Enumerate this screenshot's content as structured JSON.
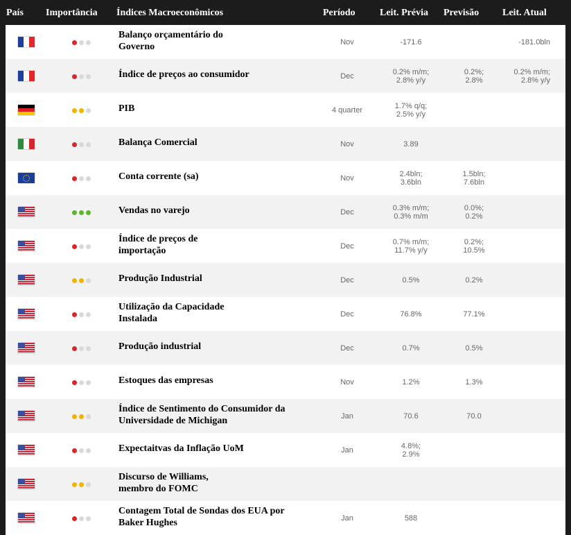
{
  "header": {
    "country": "País",
    "importance": "Importância",
    "indicator": "Índices Macroeconômicos",
    "period": "Período",
    "previous": "Leit. Prévia",
    "forecast": "Previsão",
    "actual": "Leit. Atual"
  },
  "colors": {
    "importance_low": "#d6282b",
    "importance_medium": "#f0b400",
    "importance_high": "#5cb82a",
    "dot_inactive": "#d9d9d9"
  },
  "rows": [
    {
      "flag": "france-flag-icon",
      "importance": "low",
      "name": [
        "Balanço orçamentário do",
        "Governo"
      ],
      "period": "Nov",
      "previous": [
        "-171.6"
      ],
      "forecast": [],
      "actual": [
        "-181.0bln"
      ]
    },
    {
      "flag": "france-flag-icon",
      "importance": "low",
      "name": [
        "Índice de preços ao consumidor"
      ],
      "period": "Dec",
      "previous": [
        "0.2% m/m;",
        "2.8% y/y"
      ],
      "forecast": [
        "0.2%;",
        "2.8%"
      ],
      "actual": [
        "0.2% m/m;",
        "2.8% y/y"
      ]
    },
    {
      "flag": "germany-flag-icon",
      "importance": "medium",
      "name": [
        "PIB"
      ],
      "period": "4 quarter",
      "previous": [
        "1.7% q/q;",
        "2.5% y/y"
      ],
      "forecast": [],
      "actual": []
    },
    {
      "flag": "italy-flag-icon",
      "importance": "low",
      "name": [
        "Balança Comercial"
      ],
      "period": "Nov",
      "previous": [
        "3.89"
      ],
      "forecast": [],
      "actual": []
    },
    {
      "flag": "eu-flag-icon",
      "importance": "low",
      "name": [
        "Conta corrente (sa)"
      ],
      "period": "Nov",
      "previous": [
        "2.4bln;",
        "3.6bln"
      ],
      "forecast": [
        "1.5bln;",
        "7.6bln"
      ],
      "actual": []
    },
    {
      "flag": "usa-flag-icon",
      "importance": "high",
      "name": [
        "Vendas no varejo"
      ],
      "period": "Dec",
      "previous": [
        "0.3% m/m;",
        "0.3% m/m"
      ],
      "forecast": [
        "0.0%;",
        "0.2%"
      ],
      "actual": []
    },
    {
      "flag": "usa-flag-icon",
      "importance": "low",
      "name": [
        "Índice de preços de",
        "importação"
      ],
      "period": "Dec",
      "previous": [
        "0.7% m/m;",
        "11.7% y/y"
      ],
      "forecast": [
        "0.2%;",
        "10.5%"
      ],
      "actual": []
    },
    {
      "flag": "usa-flag-icon",
      "importance": "medium",
      "name": [
        "Produção Industrial"
      ],
      "period": "Dec",
      "previous": [
        "0.5%"
      ],
      "forecast": [
        "0.2%"
      ],
      "actual": []
    },
    {
      "flag": "usa-flag-icon",
      "importance": "low",
      "name": [
        "Utilização da Capacidade",
        "Instalada"
      ],
      "period": "Dec",
      "previous": [
        "76.8%"
      ],
      "forecast": [
        "77.1%"
      ],
      "actual": []
    },
    {
      "flag": "usa-flag-icon",
      "importance": "low",
      "name": [
        "Produção industrial"
      ],
      "period": "Dec",
      "previous": [
        "0.7%"
      ],
      "forecast": [
        "0.5%"
      ],
      "actual": []
    },
    {
      "flag": "usa-flag-icon",
      "importance": "low",
      "name": [
        "Estoques das empresas"
      ],
      "period": "Nov",
      "previous": [
        "1.2%"
      ],
      "forecast": [
        "1.3%"
      ],
      "actual": []
    },
    {
      "flag": "usa-flag-icon",
      "importance": "medium",
      "name": [
        "Índice de Sentimento do Consumidor da",
        "Universidade de Michigan"
      ],
      "period": "Jan",
      "previous": [
        "70.6"
      ],
      "forecast": [
        "70.0"
      ],
      "actual": []
    },
    {
      "flag": "usa-flag-icon",
      "importance": "low",
      "name": [
        "Expectaitvas da Inflação UoM"
      ],
      "period": "Jan",
      "previous": [
        "4.8%;",
        "2.9%"
      ],
      "forecast": [],
      "actual": []
    },
    {
      "flag": "usa-flag-icon",
      "importance": "medium",
      "name": [
        "Discurso de Williams,",
        "membro do FOMC"
      ],
      "period": "",
      "previous": [],
      "forecast": [],
      "actual": []
    },
    {
      "flag": "usa-flag-icon",
      "importance": "low",
      "name": [
        "Contagem Total de Sondas dos EUA por",
        "Baker Hughes"
      ],
      "period": "Jan",
      "previous": [
        "588"
      ],
      "forecast": [],
      "actual": []
    }
  ]
}
